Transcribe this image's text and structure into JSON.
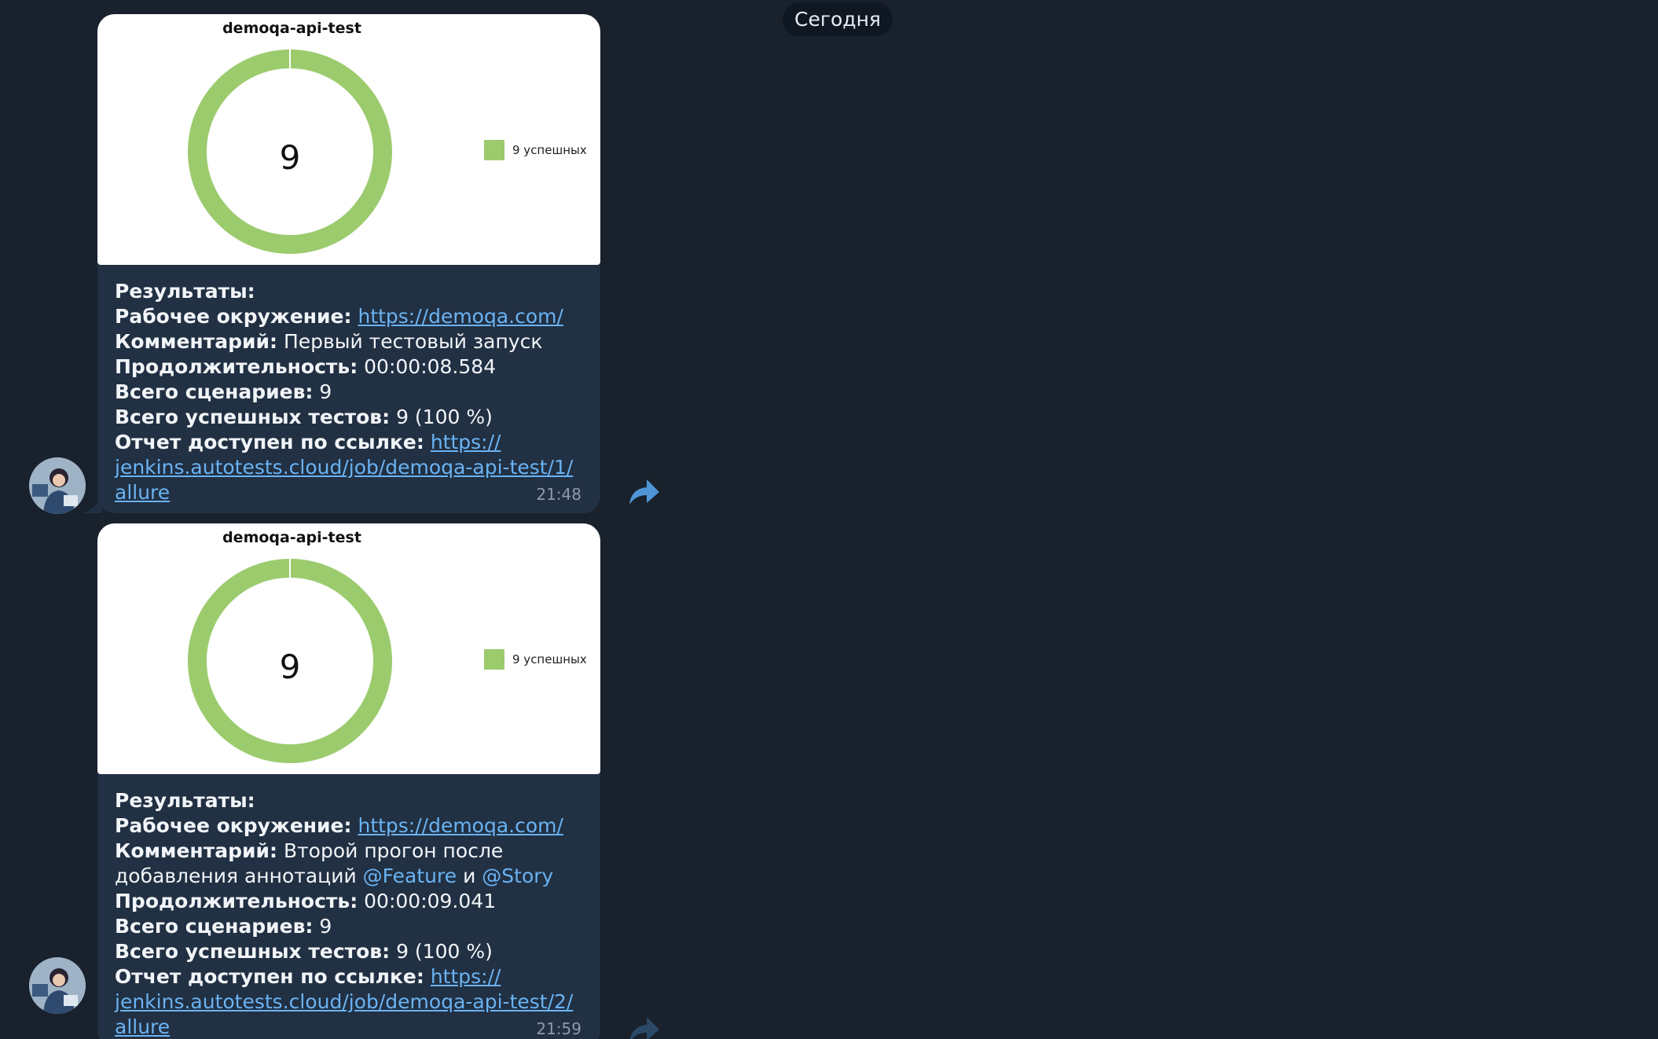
{
  "date_separator": "Сегодня",
  "messages": [
    {
      "chart_title": "demoqa-api-test",
      "chart_center_value": "9",
      "legend_label": "9 успешных",
      "results_label": "Результаты:",
      "env_label": "Рабочее окружение:",
      "env_url": "https://demoqa.com/",
      "comment_label": "Комментарий:",
      "comment_line1": "Первый тестовый запуск",
      "comment_line2": "",
      "mention_feature": "",
      "comment_and": "",
      "mention_story": "",
      "duration_label": "Продолжительность:",
      "duration": "00:00:08.584",
      "scenarios_label": "Всего сценариев:",
      "scenarios": "9",
      "passed_label": "Всего успешных тестов:",
      "passed": "9 (100 %)",
      "report_label": "Отчет доступен по ссылке:",
      "report_url_part1": "https://",
      "report_url_part2": "jenkins.autotests.cloud/job/demoqa-api-test/1/",
      "report_url_part3": "allure",
      "time": "21:48"
    },
    {
      "chart_title": "demoqa-api-test",
      "chart_center_value": "9",
      "legend_label": "9 успешных",
      "results_label": "Результаты:",
      "env_label": "Рабочее окружение:",
      "env_url": "https://demoqa.com/",
      "comment_label": "Комментарий:",
      "comment_line1": "Второй прогон после",
      "comment_line2": "добавления аннотаций",
      "mention_feature": "@Feature",
      "comment_and": "и",
      "mention_story": "@Story",
      "duration_label": "Продолжительность:",
      "duration": "00:00:09.041",
      "scenarios_label": "Всего сценариев:",
      "scenarios": "9",
      "passed_label": "Всего успешных тестов:",
      "passed": "9 (100 %)",
      "report_label": "Отчет доступен по ссылке:",
      "report_url_part1": "https://",
      "report_url_part2": "jenkins.autotests.cloud/job/demoqa-api-test/2/",
      "report_url_part3": "allure",
      "time": "21:59"
    }
  ],
  "chart_data": [
    {
      "type": "pie",
      "title": "demoqa-api-test",
      "categories": [
        "9 успешных"
      ],
      "values": [
        9
      ],
      "legend": "right",
      "colors": [
        "#9ccb6e"
      ]
    },
    {
      "type": "pie",
      "title": "demoqa-api-test",
      "categories": [
        "9 успешных"
      ],
      "values": [
        9
      ],
      "legend": "right",
      "colors": [
        "#9ccb6e"
      ]
    }
  ],
  "colors": {
    "background": "#18212c",
    "bubble": "#213043",
    "link": "#6ab3f3",
    "passed_green": "#9ccb6e"
  },
  "icons": {
    "share": "share-arrow-icon",
    "avatar": "user-avatar"
  }
}
